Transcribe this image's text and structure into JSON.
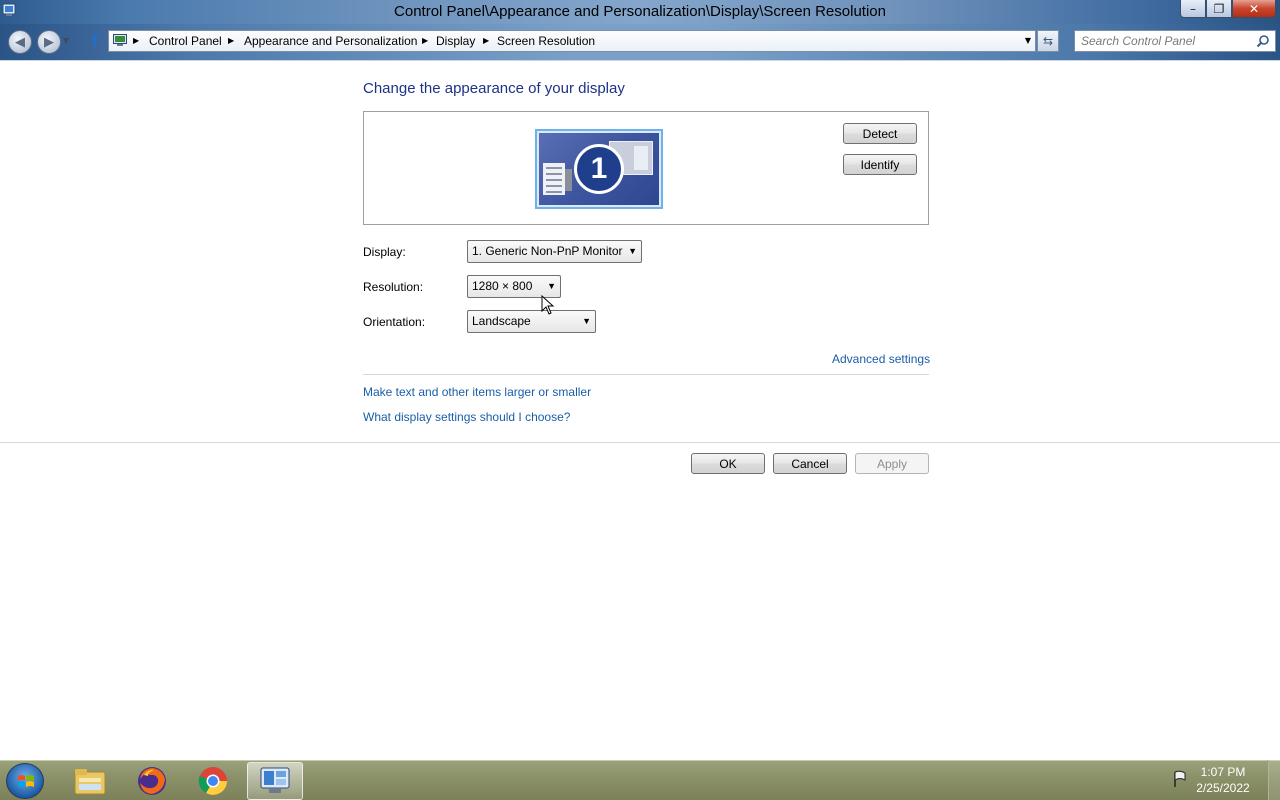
{
  "window": {
    "title": "Control Panel\\Appearance and Personalization\\Display\\Screen Resolution",
    "minimize": "–",
    "maximize": "❐",
    "close": "✕"
  },
  "address": {
    "breadcrumbs": [
      "Control Panel",
      "Appearance and Personalization",
      "Display",
      "Screen Resolution"
    ]
  },
  "search": {
    "placeholder": "Search Control Panel"
  },
  "main": {
    "heading": "Change the appearance of your display",
    "monitor_number": "1",
    "detect_label": "Detect",
    "identify_label": "Identify",
    "display_label": "Display:",
    "display_value": "1. Generic Non-PnP Monitor",
    "resolution_label": "Resolution:",
    "resolution_value": "1280 × 800",
    "orientation_label": "Orientation:",
    "orientation_value": "Landscape",
    "advanced_link": "Advanced settings",
    "text_size_link": "Make text and other items larger or smaller",
    "help_link": "What display settings should I choose?"
  },
  "footer": {
    "ok": "OK",
    "cancel": "Cancel",
    "apply": "Apply"
  },
  "taskbar": {
    "time": "1:07 PM",
    "date": "2/25/2022",
    "icons": [
      "windows-start",
      "file-explorer",
      "firefox",
      "chrome",
      "control-panel"
    ]
  }
}
